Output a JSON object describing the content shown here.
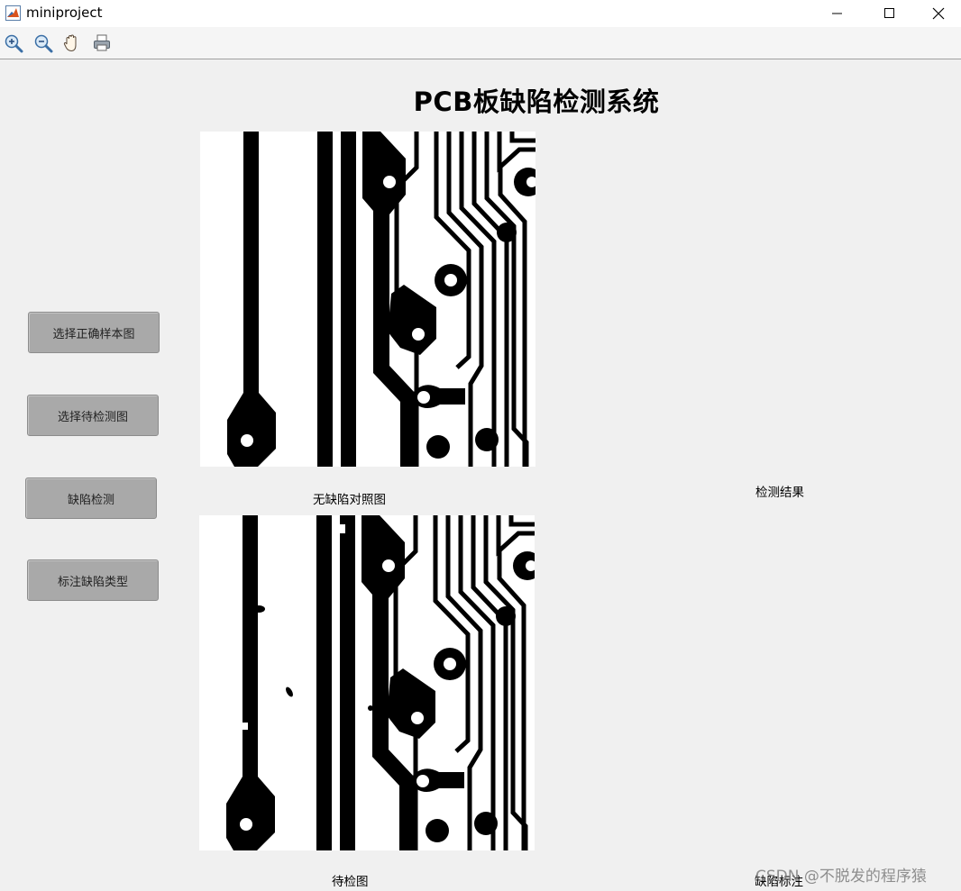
{
  "window": {
    "title": "miniproject",
    "minimize_icon": "minimize-icon",
    "maximize_icon": "maximize-icon",
    "close_icon": "close-icon"
  },
  "toolbar": {
    "tools": [
      {
        "icon": "zoom-in-icon"
      },
      {
        "icon": "zoom-out-icon"
      },
      {
        "icon": "pan-hand-icon"
      },
      {
        "icon": "print-icon"
      }
    ]
  },
  "page_title": "PCB板缺陷检测系统",
  "buttons": {
    "select_reference": "选择正确样本图",
    "select_test": "选择待检测图",
    "detect_defects": "缺陷检测",
    "label_defect_types": "标注缺陷类型"
  },
  "panels": {
    "reference_caption": "无缺陷对照图",
    "test_caption": "待检图",
    "result_caption": "检测结果",
    "annotation_caption": "缺陷标注"
  },
  "watermark": "CSDN @不脱发的程序猿",
  "colors": {
    "background": "#f0f0f0",
    "button_face": "#a9a9a9",
    "pcb_trace": "#000000",
    "pcb_substrate": "#ffffff"
  }
}
